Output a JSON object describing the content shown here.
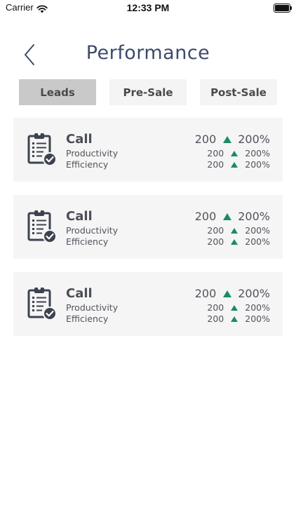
{
  "status": {
    "carrier": "Carrier",
    "time": "12:33 PM"
  },
  "header": {
    "title": "Performance"
  },
  "tabs": [
    {
      "label": "Leads",
      "active": true
    },
    {
      "label": "Pre-Sale",
      "active": false
    },
    {
      "label": "Post-Sale",
      "active": false
    }
  ],
  "colors": {
    "accent_up": "#1a8a6a",
    "title": "#3f4a6a",
    "active_tab": "#c9c9c9"
  },
  "cards": [
    {
      "icon": "clipboard-check-icon",
      "title": "Call",
      "row1_label": "Productivity",
      "row2_label": "Efficiency",
      "main_value": "200",
      "main_percent": "200%",
      "row1_value": "200",
      "row1_percent": "200%",
      "row2_value": "200",
      "row2_percent": "200%"
    },
    {
      "icon": "clipboard-check-icon",
      "title": "Call",
      "row1_label": "Productivity",
      "row2_label": "Efficiency",
      "main_value": "200",
      "main_percent": "200%",
      "row1_value": "200",
      "row1_percent": "200%",
      "row2_value": "200",
      "row2_percent": "200%"
    },
    {
      "icon": "clipboard-check-icon",
      "title": "Call",
      "row1_label": "Productivity",
      "row2_label": "Efficiency",
      "main_value": "200",
      "main_percent": "200%",
      "row1_value": "200",
      "row1_percent": "200%",
      "row2_value": "200",
      "row2_percent": "200%"
    }
  ]
}
